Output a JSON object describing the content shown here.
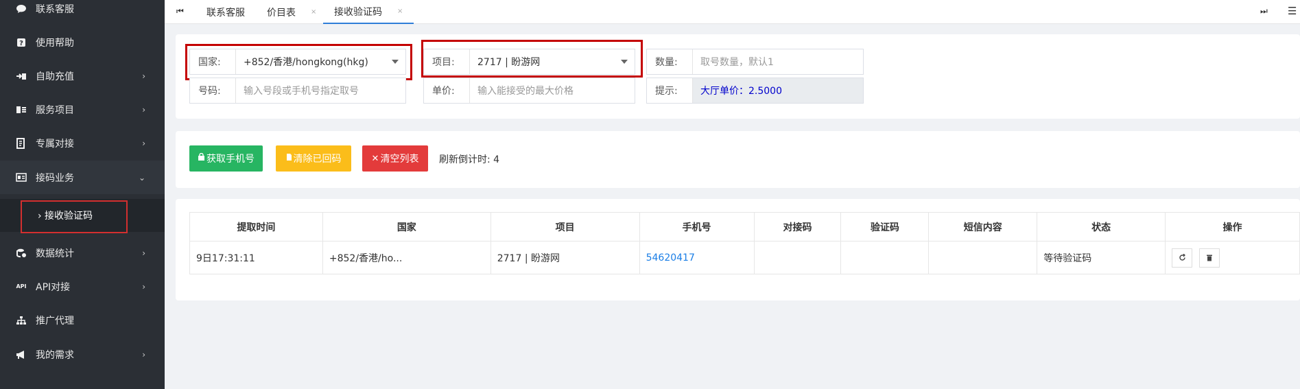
{
  "sidebar": {
    "items": [
      {
        "label": "联系客服",
        "icon": "chat-icon",
        "glyph": "💬",
        "arrow": ""
      },
      {
        "label": "使用帮助",
        "icon": "help-icon",
        "glyph": "?",
        "arrow": ""
      },
      {
        "label": "自助充值",
        "icon": "recharge-icon",
        "glyph": "⇥",
        "arrow": "›"
      },
      {
        "label": "服务项目",
        "icon": "card-icon",
        "glyph": "▤",
        "arrow": "›"
      },
      {
        "label": "专属对接",
        "icon": "document-icon",
        "glyph": "▦",
        "arrow": "›"
      },
      {
        "label": "接码业务",
        "icon": "id-card-icon",
        "glyph": "▣",
        "arrow": "⌄"
      },
      {
        "label": "数据统计",
        "icon": "database-icon",
        "glyph": "◎",
        "arrow": "›"
      },
      {
        "label": "API对接",
        "icon": "api-icon",
        "glyph": "API",
        "arrow": "›"
      },
      {
        "label": "推广代理",
        "icon": "sitemap-icon",
        "glyph": "♣",
        "arrow": ""
      },
      {
        "label": "我的需求",
        "icon": "bullhorn-icon",
        "glyph": "◀",
        "arrow": "›"
      }
    ],
    "sub_item": "› 接收验证码"
  },
  "tabs": [
    {
      "label": "联系客服",
      "close": ""
    },
    {
      "label": "价目表",
      "close": "×"
    },
    {
      "label": "接收验证码",
      "close": "×"
    }
  ],
  "top_icons": {
    "first": "⏮",
    "last": "⏭",
    "menu": "☰"
  },
  "form": {
    "country": {
      "label": "国家:",
      "value": "+852/香港/hongkong(hkg)"
    },
    "project": {
      "label": "项目:",
      "value": "2717 | 盼游网"
    },
    "quantity": {
      "label": "数量:",
      "placeholder": "取号数量，默认1"
    },
    "number": {
      "label": "号码:",
      "placeholder": "输入号段或手机号指定取号"
    },
    "price": {
      "label": "单价:",
      "placeholder": "输入能接受的最大价格"
    },
    "hint": {
      "label": "提示:",
      "value": "大厅单价：2.5000"
    }
  },
  "actions": {
    "get_number": "获取手机号",
    "clear_received": "清除已回码",
    "clear_list": "清空列表",
    "countdown": "刷新倒计时: 4",
    "colors": {
      "green": "#27b562",
      "yellow": "#fbbd1a",
      "red": "#e33b3b"
    }
  },
  "table": {
    "headers": [
      "提取时间",
      "国家",
      "项目",
      "手机号",
      "对接码",
      "验证码",
      "短信内容",
      "状态",
      "操作"
    ],
    "rows": [
      {
        "time": "9日17:31:11",
        "country": "+852/香港/ho...",
        "project": "2717 | 盼游网",
        "phone": "54620417",
        "dock_code": "",
        "code": "",
        "sms": "",
        "status": "等待验证码"
      }
    ]
  }
}
